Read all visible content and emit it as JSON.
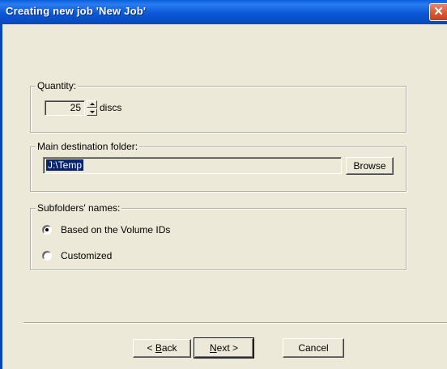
{
  "window": {
    "title": "Creating new job 'New Job'",
    "close_glyph": "✕"
  },
  "quantity": {
    "legend": "Quantity:",
    "value": "25",
    "units": "discs"
  },
  "destination": {
    "legend": "Main destination folder:",
    "path": "J:\\Temp",
    "browse_label": "Browse"
  },
  "subfolders": {
    "legend": "Subfolders' names:",
    "options": [
      {
        "label": "Based on the Volume IDs",
        "selected": true
      },
      {
        "label": "Customized",
        "selected": false
      }
    ]
  },
  "buttons": {
    "back": {
      "prefix": "< ",
      "mnemonic": "B",
      "rest": "ack"
    },
    "next": {
      "mnemonic": "N",
      "rest": "ext >"
    },
    "cancel": "Cancel"
  }
}
